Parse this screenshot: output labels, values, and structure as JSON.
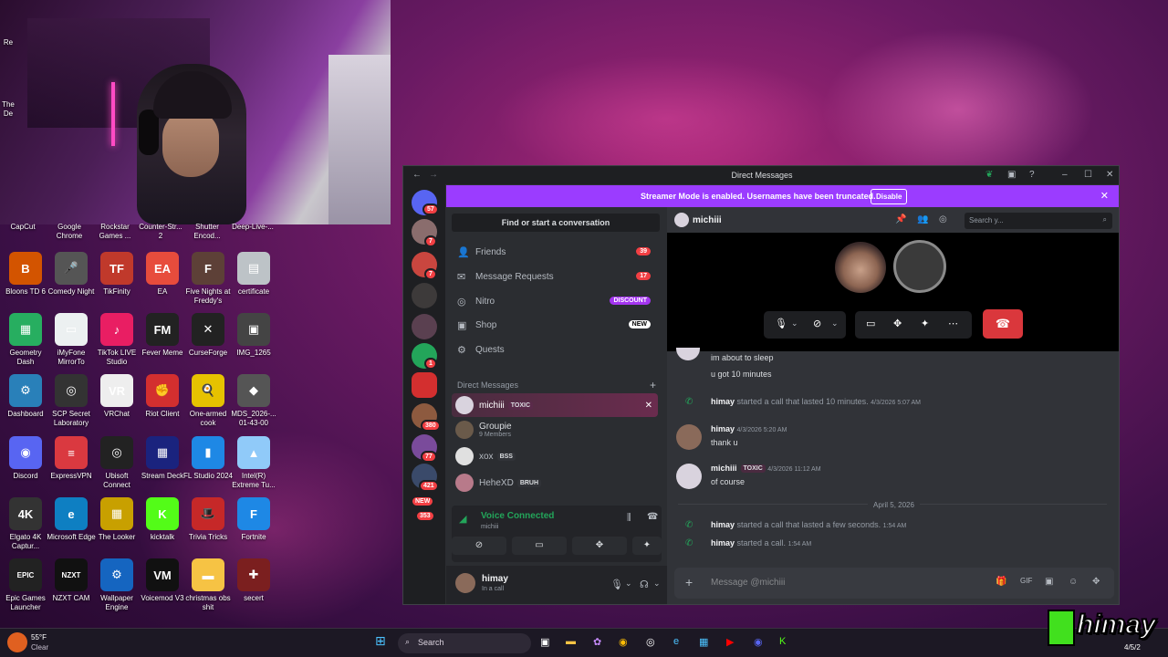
{
  "desktop": {
    "top_labels": [
      "CapCut",
      "Google Chrome",
      "Rockstar Games ...",
      "Counter-Str... 2",
      "Shutter Encod...",
      "Deep-Live-..."
    ],
    "left_fragments": [
      "Re",
      "The",
      "De"
    ],
    "icons": [
      {
        "label": "Bloons TD 6",
        "icon": "bloons-icon",
        "color": "#d35400",
        "glyph": "B"
      },
      {
        "label": "Comedy Night",
        "icon": "microphone-icon",
        "color": "#555",
        "glyph": "🎤"
      },
      {
        "label": "TikFinity",
        "icon": "tikfinity-icon",
        "color": "#c0392b",
        "glyph": "TF"
      },
      {
        "label": "EA",
        "icon": "ea-icon",
        "color": "#e74c3c",
        "glyph": "EA"
      },
      {
        "label": "Five Nights at Freddy's",
        "icon": "fnaf-icon",
        "color": "#5d4037",
        "glyph": "F"
      },
      {
        "label": "certificate",
        "icon": "certificate-icon",
        "color": "#bdc3c7",
        "glyph": "▤"
      },
      {
        "label": "Geometry Dash",
        "icon": "geometry-dash-icon",
        "color": "#27ae60",
        "glyph": "▦"
      },
      {
        "label": "iMyFone MirrorTo",
        "icon": "mirrorto-icon",
        "color": "#ecf0f1",
        "glyph": "▭"
      },
      {
        "label": "TikTok LIVE Studio",
        "icon": "tiktok-icon",
        "color": "#e91e63",
        "glyph": "♪"
      },
      {
        "label": "Fever Meme",
        "icon": "fever-meme-icon",
        "color": "#222",
        "glyph": "FM"
      },
      {
        "label": "CurseForge",
        "icon": "curseforge-icon",
        "color": "#222",
        "glyph": "✕"
      },
      {
        "label": "IMG_1265",
        "icon": "image-icon",
        "color": "#444",
        "glyph": "▣"
      },
      {
        "label": "Dashboard",
        "icon": "dashboard-icon",
        "color": "#2980b9",
        "glyph": "⚙"
      },
      {
        "label": "SCP Secret Laboratory",
        "icon": "scp-icon",
        "color": "#333",
        "glyph": "◎"
      },
      {
        "label": "VRChat",
        "icon": "vrchat-icon",
        "color": "#eee",
        "glyph": "VR"
      },
      {
        "label": "Riot Client",
        "icon": "riot-icon",
        "color": "#d32f2f",
        "glyph": "✊"
      },
      {
        "label": "One-armed cook",
        "icon": "one-armed-cook-icon",
        "color": "#e6c200",
        "glyph": "🍳"
      },
      {
        "label": "MDS_2026-... 01-43-00",
        "icon": "file-icon",
        "color": "#555",
        "glyph": "◆"
      },
      {
        "label": "Discord",
        "icon": "discord-icon",
        "color": "#5865f2",
        "glyph": "◉"
      },
      {
        "label": "ExpressVPN",
        "icon": "expressvpn-icon",
        "color": "#da3940",
        "glyph": "≡"
      },
      {
        "label": "Ubisoft Connect",
        "icon": "ubisoft-icon",
        "color": "#222",
        "glyph": "◎"
      },
      {
        "label": "Stream Deck",
        "icon": "stream-deck-icon",
        "color": "#1a237e",
        "glyph": "▦"
      },
      {
        "label": "FL Studio 2024",
        "icon": "fl-studio-icon",
        "color": "#1e88e5",
        "glyph": "▮"
      },
      {
        "label": "Intel(R) Extreme Tu...",
        "icon": "intel-icon",
        "color": "#90caf9",
        "glyph": "▲"
      },
      {
        "label": "Elgato 4K Captur...",
        "icon": "elgato-icon",
        "color": "#333",
        "glyph": "4K"
      },
      {
        "label": "Microsoft Edge",
        "icon": "edge-icon",
        "color": "#0e7fc2",
        "glyph": "e"
      },
      {
        "label": "The Looker",
        "icon": "the-looker-icon",
        "color": "#c8a000",
        "glyph": "▦"
      },
      {
        "label": "kicktalk",
        "icon": "kicktalk-icon",
        "color": "#53fc18",
        "glyph": "K"
      },
      {
        "label": "Trivia Tricks",
        "icon": "trivia-icon",
        "color": "#c62828",
        "glyph": "🎩"
      },
      {
        "label": "Fortnite",
        "icon": "fortnite-icon",
        "color": "#1e88e5",
        "glyph": "F"
      },
      {
        "label": "Epic Games Launcher",
        "icon": "epic-icon",
        "color": "#222",
        "glyph": "EPIC"
      },
      {
        "label": "NZXT CAM",
        "icon": "nzxt-icon",
        "color": "#111",
        "glyph": "NZXT"
      },
      {
        "label": "Wallpaper Engine",
        "icon": "wallpaper-engine-icon",
        "color": "#1565c0",
        "glyph": "⚙"
      },
      {
        "label": "Voicemod V3",
        "icon": "voicemod-icon",
        "color": "#111",
        "glyph": "VM"
      },
      {
        "label": "christmas obs shit",
        "icon": "folder-icon",
        "color": "#f6c344",
        "glyph": "▬"
      },
      {
        "label": "secert",
        "icon": "secert-icon",
        "color": "#7b1f1f",
        "glyph": "✚"
      }
    ]
  },
  "discord": {
    "window_title": "Direct Messages",
    "streamer": {
      "message": "Streamer Mode is enabled. Usernames have been truncated.",
      "disable_label": "Disable"
    },
    "guild_badges": [
      "57",
      "7",
      "1",
      "380",
      "77",
      "421",
      "NEW",
      "353"
    ],
    "finder": "Find or start a conversation",
    "nav": [
      {
        "label": "Friends",
        "badge": "39"
      },
      {
        "label": "Message Requests",
        "badge": "17"
      },
      {
        "label": "Nitro",
        "pill": "DISCOUNT"
      },
      {
        "label": "Shop",
        "pill": "NEW"
      },
      {
        "label": "Quests"
      }
    ],
    "dm_header": "Direct Messages",
    "dms": [
      {
        "name": "michiii",
        "tag": "TOXIC",
        "sub": ""
      },
      {
        "name": "Groupie",
        "tag": "",
        "sub": "9 Members"
      },
      {
        "name": "xox",
        "tag": "BSS",
        "sub": ""
      },
      {
        "name": "HeheXD",
        "tag": "BRUH",
        "sub": ""
      }
    ],
    "voice": {
      "status": "Voice Connected",
      "user": "michiii"
    },
    "user": {
      "name": "himay",
      "status": "In a call"
    },
    "chat": {
      "recipient": "michiii",
      "search_placeholder": "Search y...",
      "messages": [
        {
          "text": "im about to sleep"
        },
        {
          "text": "u got 10 minutes"
        },
        {
          "user": "himay",
          "system": "started a call that lasted 10 minutes.",
          "time": "4/3/2026 5:07 AM"
        },
        {
          "user": "himay",
          "time": "4/3/2026 5:20 AM",
          "text": "thank u"
        },
        {
          "user": "michiii",
          "tag": "TOXIC",
          "time": "4/3/2026 11:12 AM",
          "text": "of course"
        },
        {
          "divider": "April 5, 2026"
        },
        {
          "user": "himay",
          "system": "started a call that lasted a few seconds.",
          "time": "1:54 AM"
        },
        {
          "user": "himay",
          "system": "started a call.",
          "time": "1:54 AM"
        }
      ],
      "composer_placeholder": "Message @michiii"
    }
  },
  "taskbar": {
    "weather_temp": "55°F",
    "weather_text": "Clear",
    "search": "Search",
    "date_fragment": "4/5/2"
  },
  "watermark": "himay",
  "colors": {
    "accent": "#9b3cff",
    "online": "#23a55a",
    "danger": "#da373c",
    "blurple": "#5865f2"
  }
}
